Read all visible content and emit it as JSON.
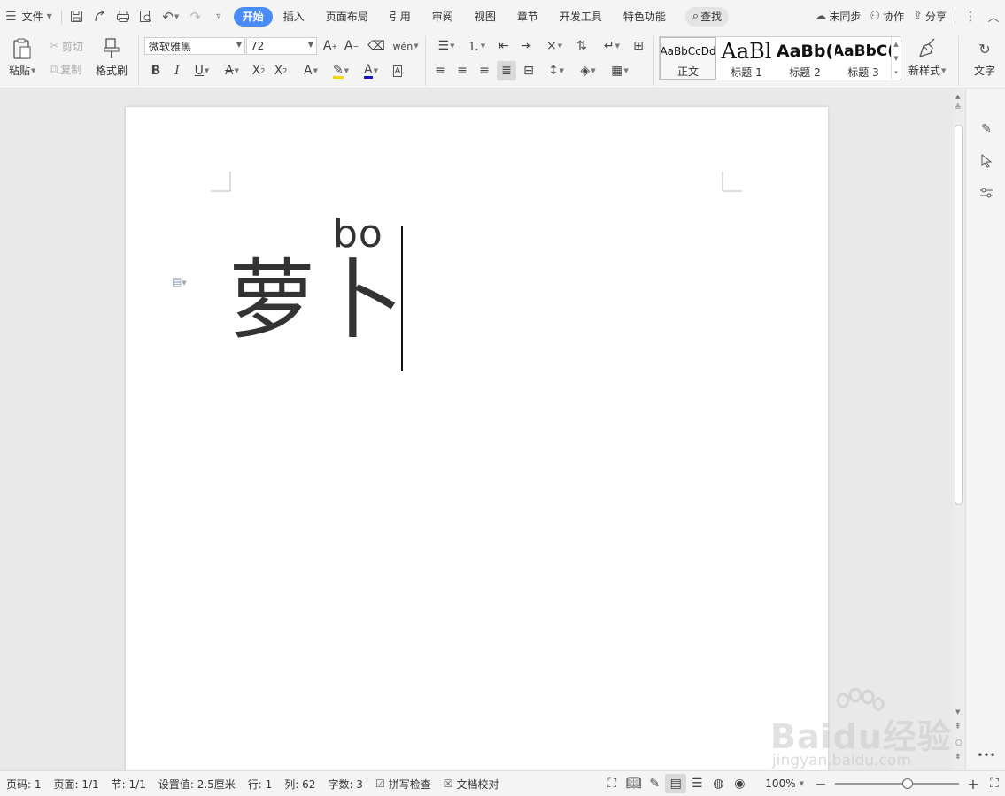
{
  "menubar": {
    "file_menu": "文件",
    "tabs": [
      {
        "label": "开始",
        "active": true
      },
      {
        "label": "插入"
      },
      {
        "label": "页面布局"
      },
      {
        "label": "引用"
      },
      {
        "label": "审阅"
      },
      {
        "label": "视图"
      },
      {
        "label": "章节"
      },
      {
        "label": "开发工具"
      },
      {
        "label": "特色功能"
      }
    ],
    "search": "查找",
    "sync": "未同步",
    "collaborate": "协作",
    "share": "分享"
  },
  "ribbon": {
    "paste": "粘贴",
    "cut": "剪切",
    "copy": "复制",
    "format_painter": "格式刷",
    "font_name": "微软雅黑",
    "font_size": "72",
    "styles": [
      {
        "sample": "AaBbCcDd",
        "label": "正文",
        "active": true
      },
      {
        "sample": "AaBl",
        "label": "标题 1"
      },
      {
        "sample": "AaBb(",
        "label": "标题 2"
      },
      {
        "sample": "AaBbC(",
        "label": "标题 3"
      }
    ],
    "new_style": "新样式",
    "text_tools": "文字"
  },
  "document": {
    "ruby_text": "bo",
    "body_text": "萝卜"
  },
  "statusbar": {
    "page_num": "页码: 1",
    "pages": "页面: 1/1",
    "section": "节: 1/1",
    "setting": "设置值: 2.5厘米",
    "line": "行: 1",
    "column": "列: 62",
    "word_count": "字数: 3",
    "spell_check": "拼写检查",
    "doc_proof": "文档校对",
    "zoom": "100%"
  },
  "zoom_level": 1.0,
  "watermark": {
    "brand": "Baidu经验",
    "url": "jingyan.baidu.com"
  },
  "colors": {
    "accent": "#4a8cf7",
    "text": "#333333"
  }
}
